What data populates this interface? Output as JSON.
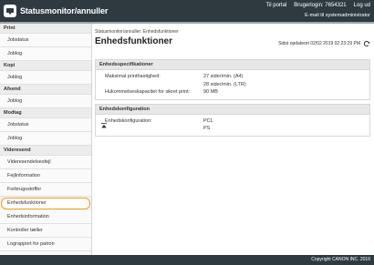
{
  "header": {
    "title": "Statusmonitor/annuller",
    "links": {
      "portal": "Til portal",
      "user": "Brugerlogin: 7654321",
      "logout": "Log ud"
    },
    "mail": "E-mail til systemadministrator"
  },
  "sidebar": {
    "sections": [
      {
        "label": "Print",
        "items": [
          {
            "label": "Jobstatus"
          },
          {
            "label": "Joblog"
          }
        ]
      },
      {
        "label": "Kopi",
        "items": [
          {
            "label": "Joblog"
          }
        ]
      },
      {
        "label": "Afsend",
        "items": [
          {
            "label": "Joblog"
          }
        ]
      },
      {
        "label": "Modtag",
        "items": [
          {
            "label": "Jobstatus"
          },
          {
            "label": "Joblog"
          }
        ]
      },
      {
        "label": "Videresend",
        "items": [
          {
            "label": "Videresendelsesfejl"
          }
        ]
      },
      {
        "label": "",
        "items": [
          {
            "label": "Fejlinformation"
          },
          {
            "label": "Forbrugsstoffer"
          },
          {
            "label": "Enhedsfunktioner",
            "active": true
          },
          {
            "label": "Enhedsinformation"
          },
          {
            "label": "Kontroller tæller"
          },
          {
            "label": "Lograpport for patron"
          },
          {
            "label": "Eco-oplysninger"
          }
        ]
      }
    ]
  },
  "main": {
    "breadcrumb": "Statusmonitor/annuller: Enhedsfunktioner",
    "title": "Enhedsfunktioner",
    "updated": "Sidst opdateret 02/02 2019 02:23:29 PM",
    "spec": {
      "heading": "Enhedsspecifikationer",
      "rows": [
        {
          "label": "Maksimal printhastighed:",
          "value": "27 sider/min. (A4)"
        },
        {
          "label": "",
          "value": "28 sider/min. (LTR)"
        },
        {
          "label": "Hukommelseskapacitet for sikret print:",
          "value": "90 MB"
        }
      ]
    },
    "config": {
      "heading": "Enhedskonfiguration",
      "rows": [
        {
          "label": "Enhedskonfiguration:",
          "value": "PCL"
        },
        {
          "label": "",
          "value": "PS"
        }
      ]
    }
  },
  "footer": {
    "copyright": "Copyright CANON INC. 2016"
  },
  "colors": {
    "topbar": "#2f3a40",
    "highlight": "#f0a11c"
  }
}
